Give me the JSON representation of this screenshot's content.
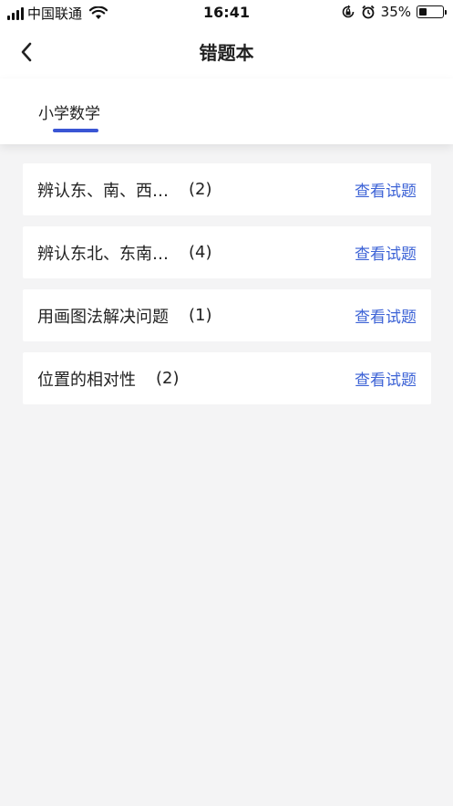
{
  "status_bar": {
    "carrier": "中国联通",
    "time": "16:41",
    "battery": "35%",
    "battery_level": 0.35,
    "icons": [
      "signal-icon",
      "wifi-icon",
      "rotation-lock-icon",
      "alarm-icon",
      "battery-icon"
    ]
  },
  "header": {
    "title": "错题本",
    "back_icon": "chevron-left-icon"
  },
  "tabs": [
    {
      "label": "小学数学",
      "selected": true
    }
  ],
  "colors": {
    "accent": "#3a55d4",
    "link": "#3d63d6",
    "background": "#f4f4f5"
  },
  "items": [
    {
      "name": "辨认东、南、西…",
      "count": "(2)",
      "action": "查看试题"
    },
    {
      "name": "辨认东北、东南…",
      "count": "(4)",
      "action": "查看试题"
    },
    {
      "name": "用画图法解决问题",
      "count": "(1)",
      "action": "查看试题"
    },
    {
      "name": "位置的相对性",
      "count": "(2)",
      "action": "查看试题"
    }
  ]
}
